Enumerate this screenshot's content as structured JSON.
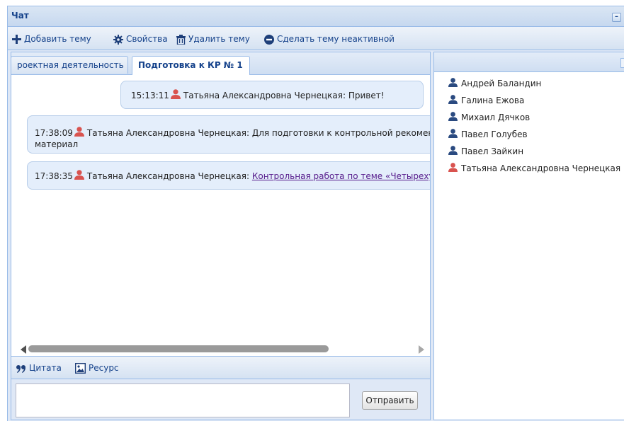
{
  "window": {
    "title": "Чат",
    "minimize_label": "–"
  },
  "toolbar": {
    "add_topic": "Добавить тему",
    "properties": "Свойства",
    "delete_topic": "Удалить тему",
    "deactivate_topic": "Сделать тему неактивной"
  },
  "tabs": [
    {
      "label": "роектная деятельность"
    },
    {
      "label": "Подготовка к КР № 1",
      "active": true
    }
  ],
  "messages": [
    {
      "time": "15:13:11",
      "author": "Татьяна Александровна Чернецкая",
      "text": ": Привет!"
    },
    {
      "time": "17:38:09",
      "author": "Татьяна Александровна Чернецкая",
      "text": ": Для подготовки к контрольной рекомендую",
      "text2": "материал"
    },
    {
      "time": "17:38:35",
      "author": "Татьяна Александровна Чернецкая",
      "text": ": ",
      "link": "Контрольная работа по теме «Четырехугольники»"
    }
  ],
  "input_toolbar": {
    "quote": "Цитата",
    "resource": "Ресурс"
  },
  "input": {
    "value": "",
    "send_label": "Отправить"
  },
  "users_panel": {
    "expand_label": "»",
    "users": [
      {
        "name": "Андрей Баландин",
        "color": "#2a4a80"
      },
      {
        "name": "Галина Ежова",
        "color": "#2a4a80"
      },
      {
        "name": "Михаил Дячков",
        "color": "#2a4a80"
      },
      {
        "name": "Павел Голубев",
        "color": "#2a4a80"
      },
      {
        "name": "Павел Зайкин",
        "color": "#2a4a80"
      },
      {
        "name": "Татьяна Александровна Чернецкая",
        "color": "#d9534f"
      }
    ]
  },
  "colors": {
    "accent": "#15428b",
    "border": "#99bbe8",
    "bubble": "#e4eefb",
    "teacher": "#d9534f",
    "student": "#2a4a80"
  }
}
